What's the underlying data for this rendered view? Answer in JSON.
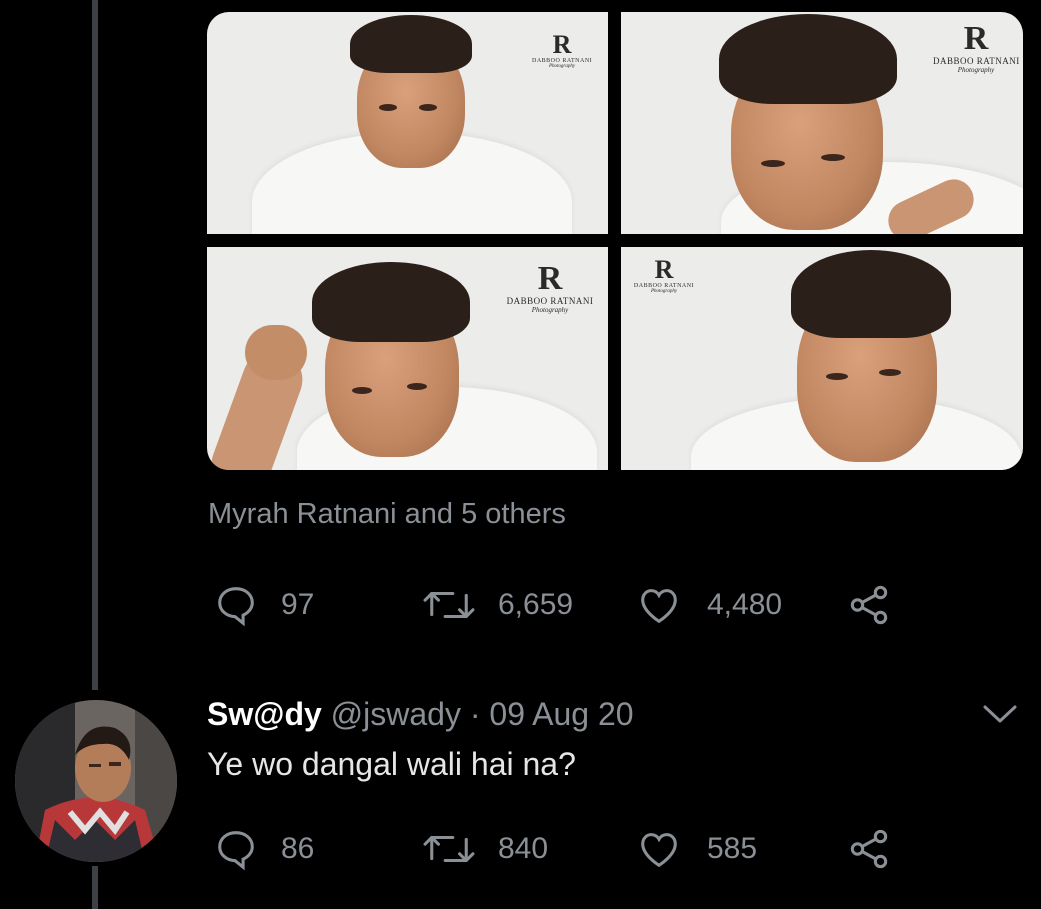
{
  "tweet": {
    "photos": [
      {
        "alt": "portrait-1",
        "watermark": {
          "mark": "R",
          "studio": "DABBOO RATNANI",
          "sub": "Photography"
        }
      },
      {
        "alt": "portrait-2",
        "watermark": {
          "mark": "R",
          "studio": "DABBOO RATNANI",
          "sub": "Photography"
        }
      },
      {
        "alt": "portrait-3",
        "watermark": {
          "mark": "R",
          "studio": "DABBOO RATNANI",
          "sub": "Photography"
        }
      },
      {
        "alt": "portrait-4",
        "watermark": {
          "mark": "R",
          "studio": "DABBOO RATNANI",
          "sub": "Photography"
        }
      }
    ],
    "tagged_people": "Myrah Ratnani and 5 others",
    "actions": {
      "reply_count": "97",
      "retweet_count": "6,659",
      "like_count": "4,480"
    }
  },
  "reply": {
    "display_name": "Sw@dy",
    "handle": "@jswady",
    "separator": "·",
    "date": "09 Aug 20",
    "text": "Ye wo dangal wali hai na?",
    "actions": {
      "reply_count": "86",
      "retweet_count": "840",
      "like_count": "585"
    }
  },
  "colors": {
    "background": "#000000",
    "secondary_text": "#8b9096",
    "thread_line": "#3d4146"
  },
  "icons": [
    "reply-icon",
    "retweet-icon",
    "like-icon",
    "share-icon",
    "chevron-down-icon"
  ]
}
